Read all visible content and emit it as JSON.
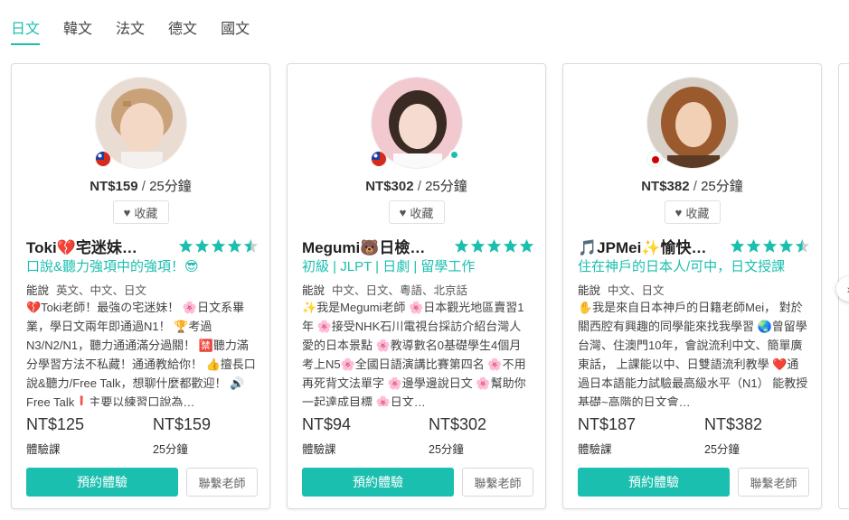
{
  "tabs": [
    "日文",
    "韓文",
    "法文",
    "德文",
    "國文"
  ],
  "active_tab": 0,
  "accent_color": "#1bbfaf",
  "fav_label": "收藏",
  "langs_label": "能說",
  "book_label": "預約體驗",
  "contact_label": "聯繫老師",
  "trial_label": "體驗課",
  "teachers": [
    {
      "price_main": "NT$159",
      "duration": "25分鐘",
      "name": "Toki💔宅迷妹…",
      "rating": 4.5,
      "headline": "口說&聽力強項中的強項！😎",
      "langs": "英文、中文、日文",
      "intro": "💔Toki老師！最強の宅迷妹！ 🌸日文系畢業，學日文兩年即通過N1！ 🏆考過N3/N2/N1，聽力通通滿分過關！ 🈲聽力滿分學習方法不私藏！通通教給你！ 👍擅長口說&聽力/Free Talk，想聊什麼都歡迎！ 🔊Free Talk❗主要以練習口說為…",
      "trial_price": "NT$125",
      "lesson_price": "NT$159",
      "flag": "taiwan-flag",
      "online": false
    },
    {
      "price_main": "NT$302",
      "duration": "25分鐘",
      "name": "Megumi🐻日檢…",
      "rating": 5,
      "headline": "初級 | JLPT | 日劇 | 留學工作",
      "langs": "中文、日文、粵語、北京話",
      "intro": "✨我是Megumi老師 🌸日本觀光地區賣習1年 🌸接受NHK石川電視台採訪介紹台灣人愛的日本景點 🌸教導數名0基礎學生4個月考上N5🌸全國日語演講比賽第四名 🌸不用再死背文法單字 🌸邊學邊說日文 🌸幫助你一起達成目標 🌸日文…",
      "trial_price": "NT$94",
      "lesson_price": "NT$302",
      "flag": "taiwan-flag",
      "online": true
    },
    {
      "price_main": "NT$382",
      "duration": "25分鐘",
      "name": "🎵JPMei✨愉快…",
      "rating": 4.5,
      "headline": "住在神戶的日本人/可中，日文授課",
      "langs": "中文、日文",
      "intro": "✋我是來自日本神戶的日籍老師Mei， 對於關西腔有興趣的同學能來找我學習 🌏曾留學台灣、住澳門10年，會說流利中文、簡單廣東話， 上課能以中、日雙語流利教學 ❤️通過日本語能力試驗最高級水平（N1） 能教授基礎~高階的日文會…",
      "trial_price": "NT$187",
      "lesson_price": "NT$382",
      "flag": "japan-flag",
      "online": false
    }
  ]
}
